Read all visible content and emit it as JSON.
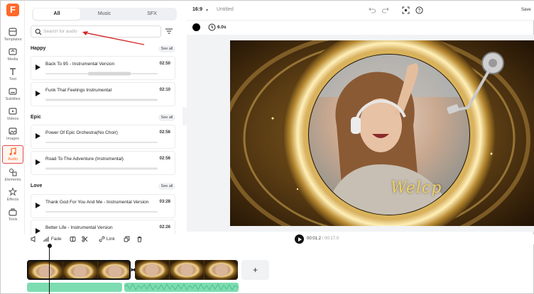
{
  "app": {
    "logo_letter": "F"
  },
  "rail": {
    "items": [
      {
        "label": "Templates"
      },
      {
        "label": "Media"
      },
      {
        "label": "Text"
      },
      {
        "label": "Subtitles"
      },
      {
        "label": "Videos"
      },
      {
        "label": "Images"
      },
      {
        "label": "Audio",
        "active": true
      },
      {
        "label": "Elements"
      },
      {
        "label": "Effects"
      },
      {
        "label": "Tools"
      }
    ]
  },
  "panel": {
    "tabs": [
      {
        "label": "All",
        "active": true
      },
      {
        "label": "Music"
      },
      {
        "label": "SFX"
      }
    ],
    "search": {
      "placeholder": "Search for audio",
      "value": ""
    },
    "categories": [
      {
        "title": "Happy",
        "see_all": "See all",
        "tracks": [
          {
            "name": "Back To 95 - Instrumental Version",
            "duration": "02:50"
          },
          {
            "name": "Funk That Feelings Instrumental",
            "duration": "02:10"
          }
        ]
      },
      {
        "title": "Epic",
        "see_all": "See all",
        "tracks": [
          {
            "name": "Power Of Epic Orchestra(No Choir)",
            "duration": "02:56"
          },
          {
            "name": "Road To The Adventure (Instrumental)",
            "duration": "02:56"
          }
        ]
      },
      {
        "title": "Love",
        "see_all": "See all",
        "tracks": [
          {
            "name": "Thank God For You And Me - Instrumental Version",
            "duration": "03:28"
          },
          {
            "name": "Better Life - Instrumental Version",
            "duration": "02:26"
          }
        ]
      }
    ]
  },
  "topbar": {
    "aspect_ratio": "16:9",
    "doc_title": "Untitled",
    "save_label": "Save",
    "icons": [
      "undo-icon",
      "redo-icon",
      "screenshot-icon",
      "help-icon"
    ]
  },
  "canvas_toolbar": {
    "background_color": "#000000",
    "duration": "6.0s"
  },
  "canvas": {
    "overlay_text": "Welcp"
  },
  "timeline": {
    "controls": {
      "fade_label": "Fade",
      "link_label": "Link"
    },
    "current_time": "00:01.2",
    "separator": " / ",
    "total_time": "00:17.0",
    "add_label": "+"
  },
  "colors": {
    "accent": "#ff6a2b",
    "audio_clip": "#7ddcb1",
    "active_outline": "#e5484d"
  }
}
